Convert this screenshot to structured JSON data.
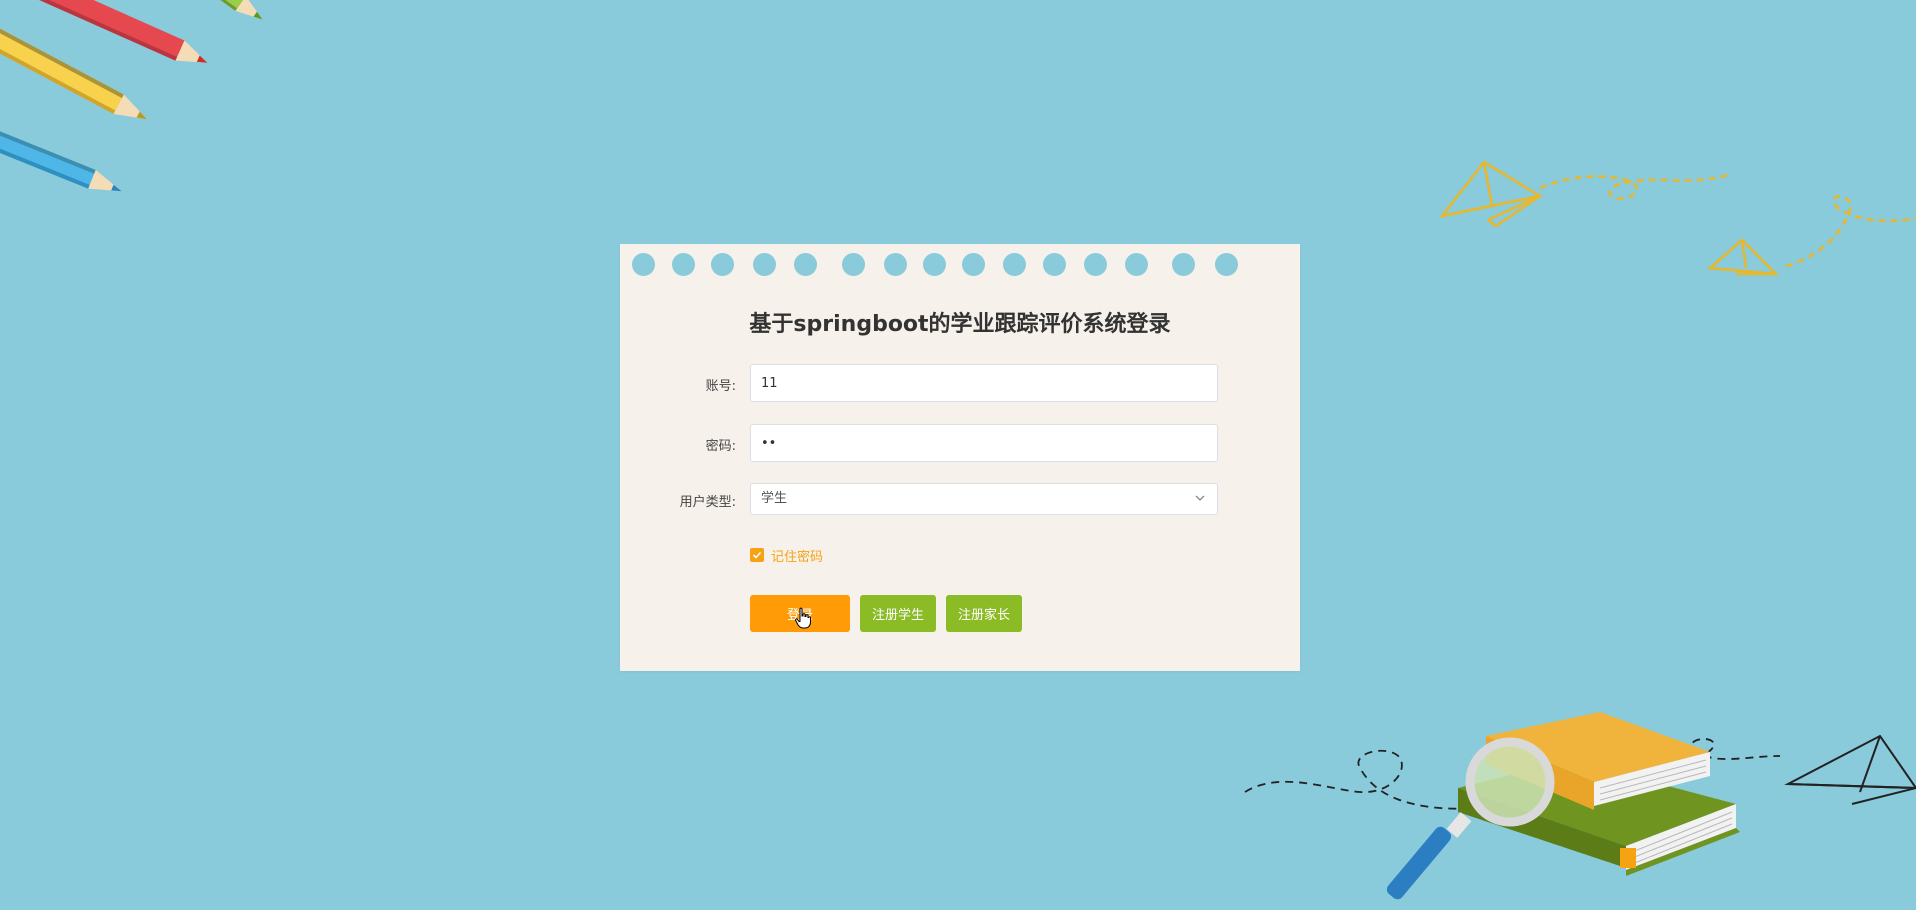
{
  "page": {
    "title": "基于springboot的学业跟踪评价系统登录"
  },
  "form": {
    "account_label": "账号:",
    "account_value": "11",
    "password_label": "密码:",
    "password_value": "••",
    "user_type_label": "用户类型:",
    "user_type_value": "学生",
    "remember_label": "记住密码",
    "remember_checked": true
  },
  "buttons": {
    "login": "登录",
    "register_student": "注册学生",
    "register_parent": "注册家长"
  },
  "colors": {
    "background": "#89cadb",
    "card": "#f6f1ea",
    "login_button": "#fe9b06",
    "register_button": "#8bbb25",
    "checkbox": "#f6a313"
  },
  "decorations": {
    "top_left": "colored-pencils",
    "top_right": "paper-airplanes",
    "bottom_right": "books-and-magnifier"
  }
}
